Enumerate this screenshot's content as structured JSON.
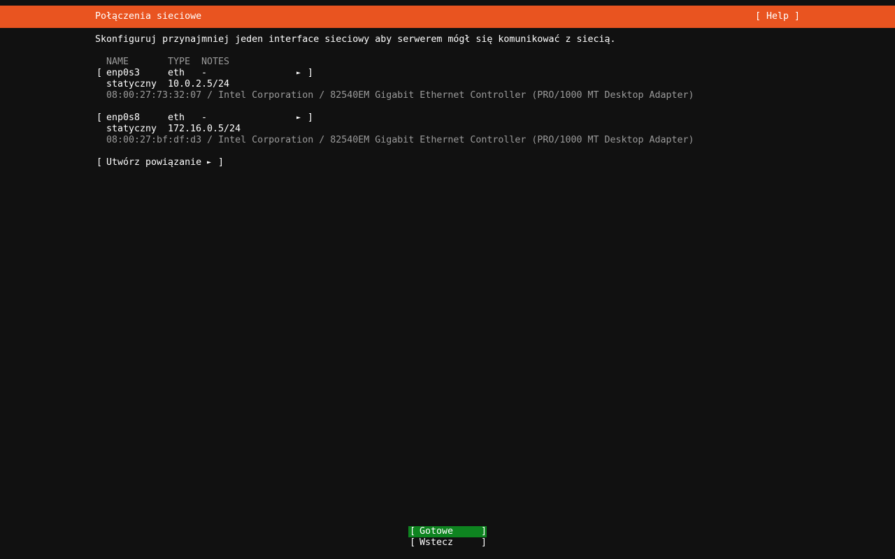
{
  "header": {
    "title": "Połączenia sieciowe",
    "help_label": "[ Help ]"
  },
  "instructions": "Skonfiguruj przynajmniej jeden interface sieciowy aby serwerem mógł się komunikować z siecią.",
  "table": {
    "columns": [
      "NAME",
      "TYPE",
      "NOTES"
    ],
    "interfaces": [
      {
        "name": "enp0s3",
        "type": "eth",
        "notes": "-",
        "mode": "statyczny",
        "address": "10.0.2.5/24",
        "details": "08:00:27:73:32:07 / Intel Corporation / 82540EM Gigabit Ethernet Controller (PRO/1000 MT Desktop Adapter)"
      },
      {
        "name": "enp0s8",
        "type": "eth",
        "notes": "-",
        "mode": "statyczny",
        "address": "172.16.0.5/24",
        "details": "08:00:27:bf:df:d3 / Intel Corporation / 82540EM Gigabit Ethernet Controller (PRO/1000 MT Desktop Adapter)"
      }
    ]
  },
  "create_bond_label": "Utwórz powiązanie",
  "brackets": {
    "open": "[",
    "close": "]"
  },
  "arrow_glyph": "►",
  "footer": {
    "done_label": "Gotowe",
    "back_label": "Wstecz"
  },
  "colors": {
    "header_bg": "#e95420",
    "selected_button_bg": "#0e8420",
    "background": "#111111",
    "dim_text": "#9a9a9a"
  }
}
